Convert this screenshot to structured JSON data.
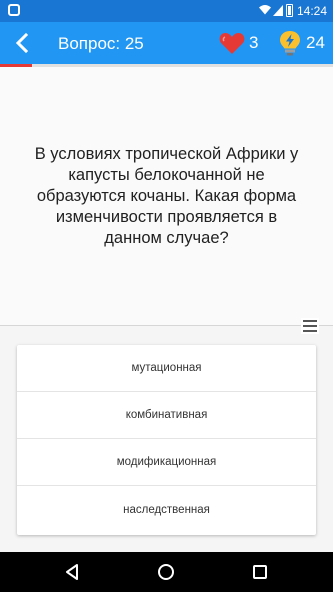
{
  "status_bar": {
    "time": "14:24",
    "icons": [
      "app-notification-icon",
      "wifi-icon",
      "signal-icon",
      "battery-icon"
    ]
  },
  "header": {
    "back_icon": "arrow-left-icon",
    "title": "Вопрос: 25",
    "lives": {
      "icon": "heart-icon",
      "count": "3",
      "color": "#e53935"
    },
    "hints": {
      "icon": "lightbulb-icon",
      "count": "24",
      "color": "#fbc02d"
    }
  },
  "progress": {
    "fraction": 0.095,
    "color": "#e53935"
  },
  "question": {
    "text": "В условиях тропической Африки у капусты белокочанной не образуются кочаны. Какая форма изменчивости проявляется в данном случае?"
  },
  "menu_icon": "menu-icon",
  "answers": [
    {
      "label": "мутационная"
    },
    {
      "label": "комбинативная"
    },
    {
      "label": "модификационная"
    },
    {
      "label": "наследственная"
    }
  ],
  "nav_bar": {
    "icons": [
      "back-triangle-icon",
      "home-circle-icon",
      "recents-square-icon"
    ]
  },
  "colors": {
    "status_bar": "#1976d2",
    "app_bar": "#2196f3",
    "background": "#f5f5f5"
  }
}
